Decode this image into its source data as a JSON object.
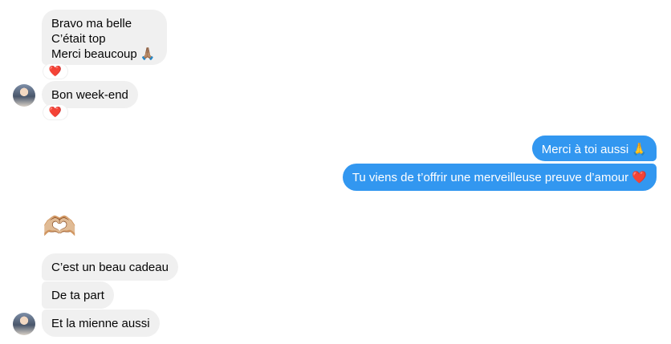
{
  "messages": {
    "received_1": {
      "lines": [
        "Bravo ma belle",
        "C’était top",
        "Merci beaucoup 🙏🏽"
      ],
      "reaction": "❤️"
    },
    "received_2": {
      "text": "Bon week-end",
      "reaction": "❤️"
    },
    "sent_1": {
      "text": "Merci à toi aussi 🙏"
    },
    "sent_2": {
      "text": "Tu viens de t’offrir une merveilleuse preuve d’amour ❤️"
    },
    "received_3": {
      "emoji": "🫶🏼"
    },
    "received_4": {
      "text": "C’est un beau cadeau"
    },
    "received_5": {
      "text": "De ta part"
    },
    "received_6": {
      "text": "Et la mienne aussi"
    }
  },
  "colors": {
    "incoming_bubble": "#f0f0f0",
    "outgoing_bubble": "#3297f0",
    "reaction_heart": "#e0245e"
  },
  "icons": {
    "avatar": "contact-avatar"
  }
}
